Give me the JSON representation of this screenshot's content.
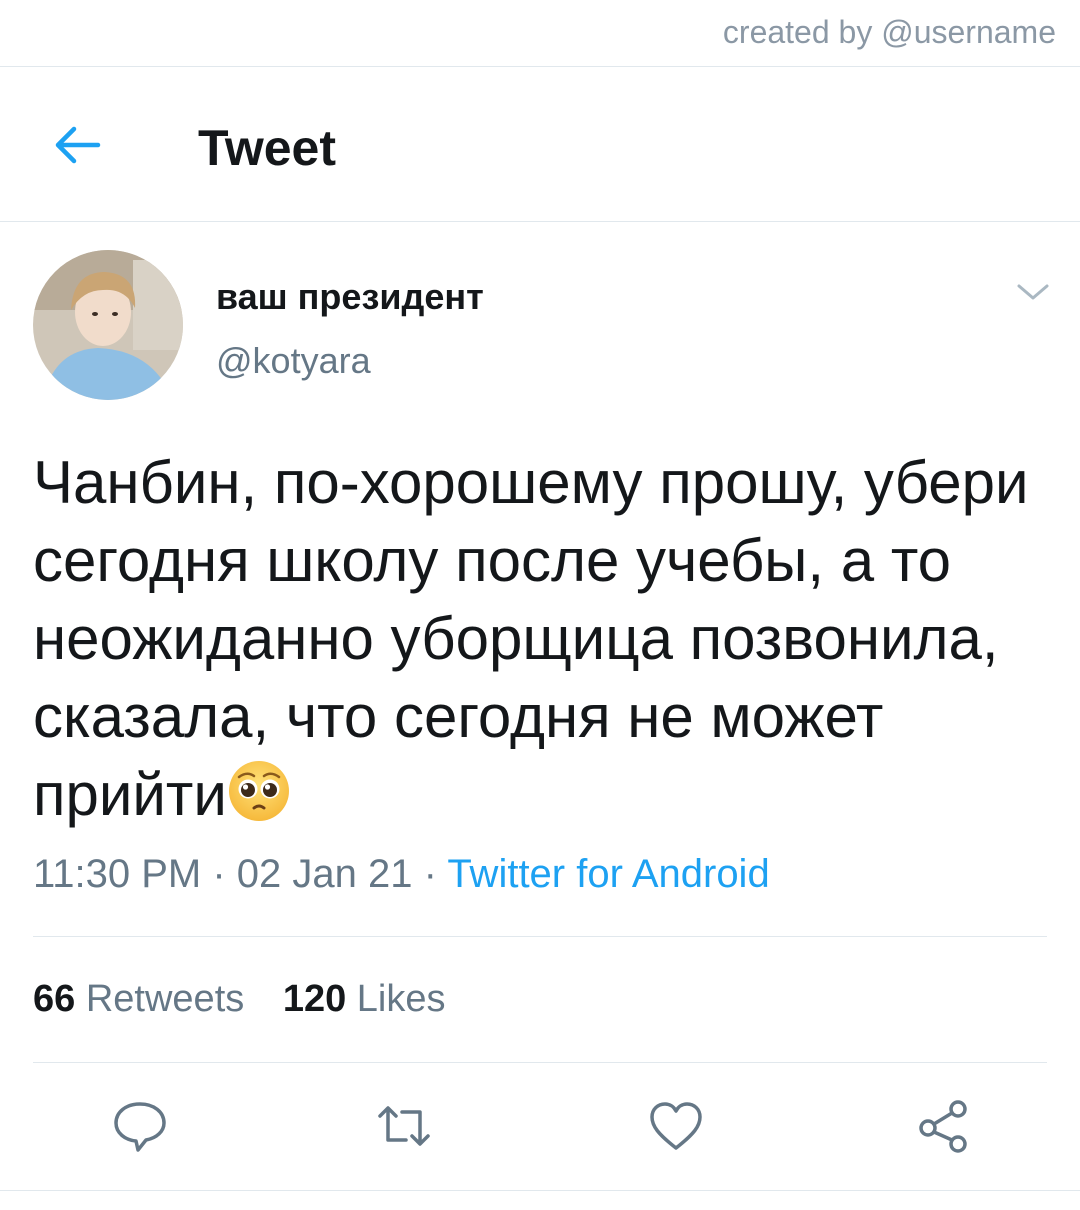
{
  "credit": {
    "text": "created by @username"
  },
  "header": {
    "title": "Tweet",
    "back_icon": "arrow-left-icon",
    "accent_color": "#1da1f2"
  },
  "author": {
    "display_name": "ваш президент",
    "handle": "@kotyara"
  },
  "tweet": {
    "text": "Чанбин, по-хорошему прошу, убери сегодня школу после учебы, а то неожиданно уборщица позвонила, сказала, что сегодня не может прийти",
    "emoji": "pleading-face-emoji",
    "time": "11:30 PM",
    "separator": " · ",
    "date": "02 Jan 21",
    "source": "Twitter for Android"
  },
  "stats": {
    "retweets_count": "66",
    "retweets_label": "Retweets",
    "likes_count": "120",
    "likes_label": "Likes"
  },
  "actions": [
    "reply-icon",
    "retweet-icon",
    "like-icon",
    "share-icon"
  ]
}
